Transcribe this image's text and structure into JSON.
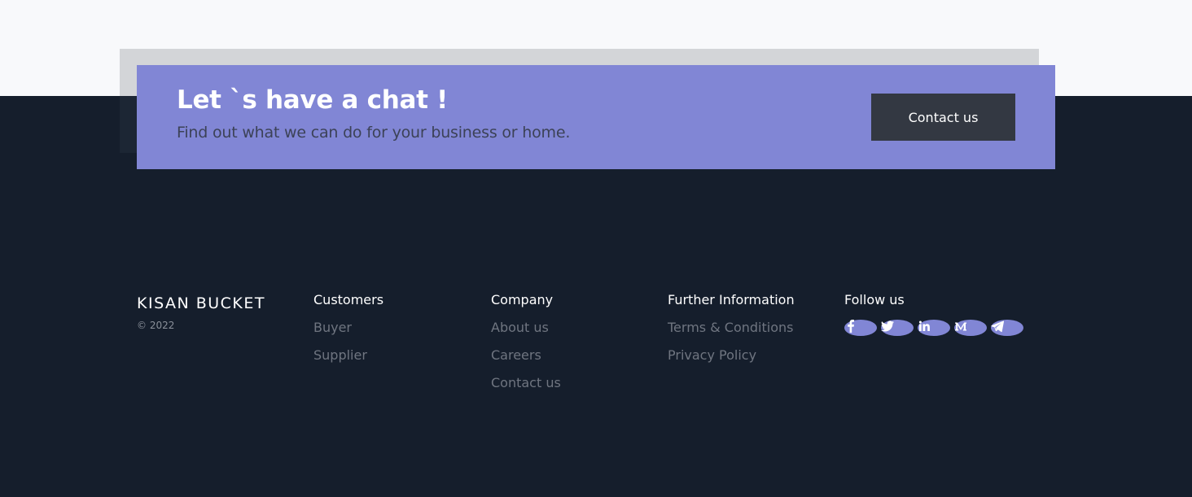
{
  "cta": {
    "title": "Let `s have a chat !",
    "subtitle": "Find out what we can do for your business or home.",
    "button_label": "Contact us"
  },
  "footer": {
    "brand": "KISAN BUCKET",
    "copyright": "© 2022",
    "columns": [
      {
        "heading": "Customers",
        "links": [
          "Buyer",
          "Supplier"
        ]
      },
      {
        "heading": "Company",
        "links": [
          "About us",
          "Careers",
          "Contact us"
        ]
      },
      {
        "heading": "Further Information",
        "links": [
          "Terms & Conditions",
          "Privacy Policy"
        ]
      }
    ],
    "follow": {
      "heading": "Follow us",
      "icons": [
        "facebook-icon",
        "twitter-icon",
        "linkedin-icon",
        "medium-icon",
        "telegram-icon"
      ]
    }
  },
  "colors": {
    "accent": "#8186d5",
    "footer_bg": "#151e2c",
    "button_bg": "#333842"
  }
}
